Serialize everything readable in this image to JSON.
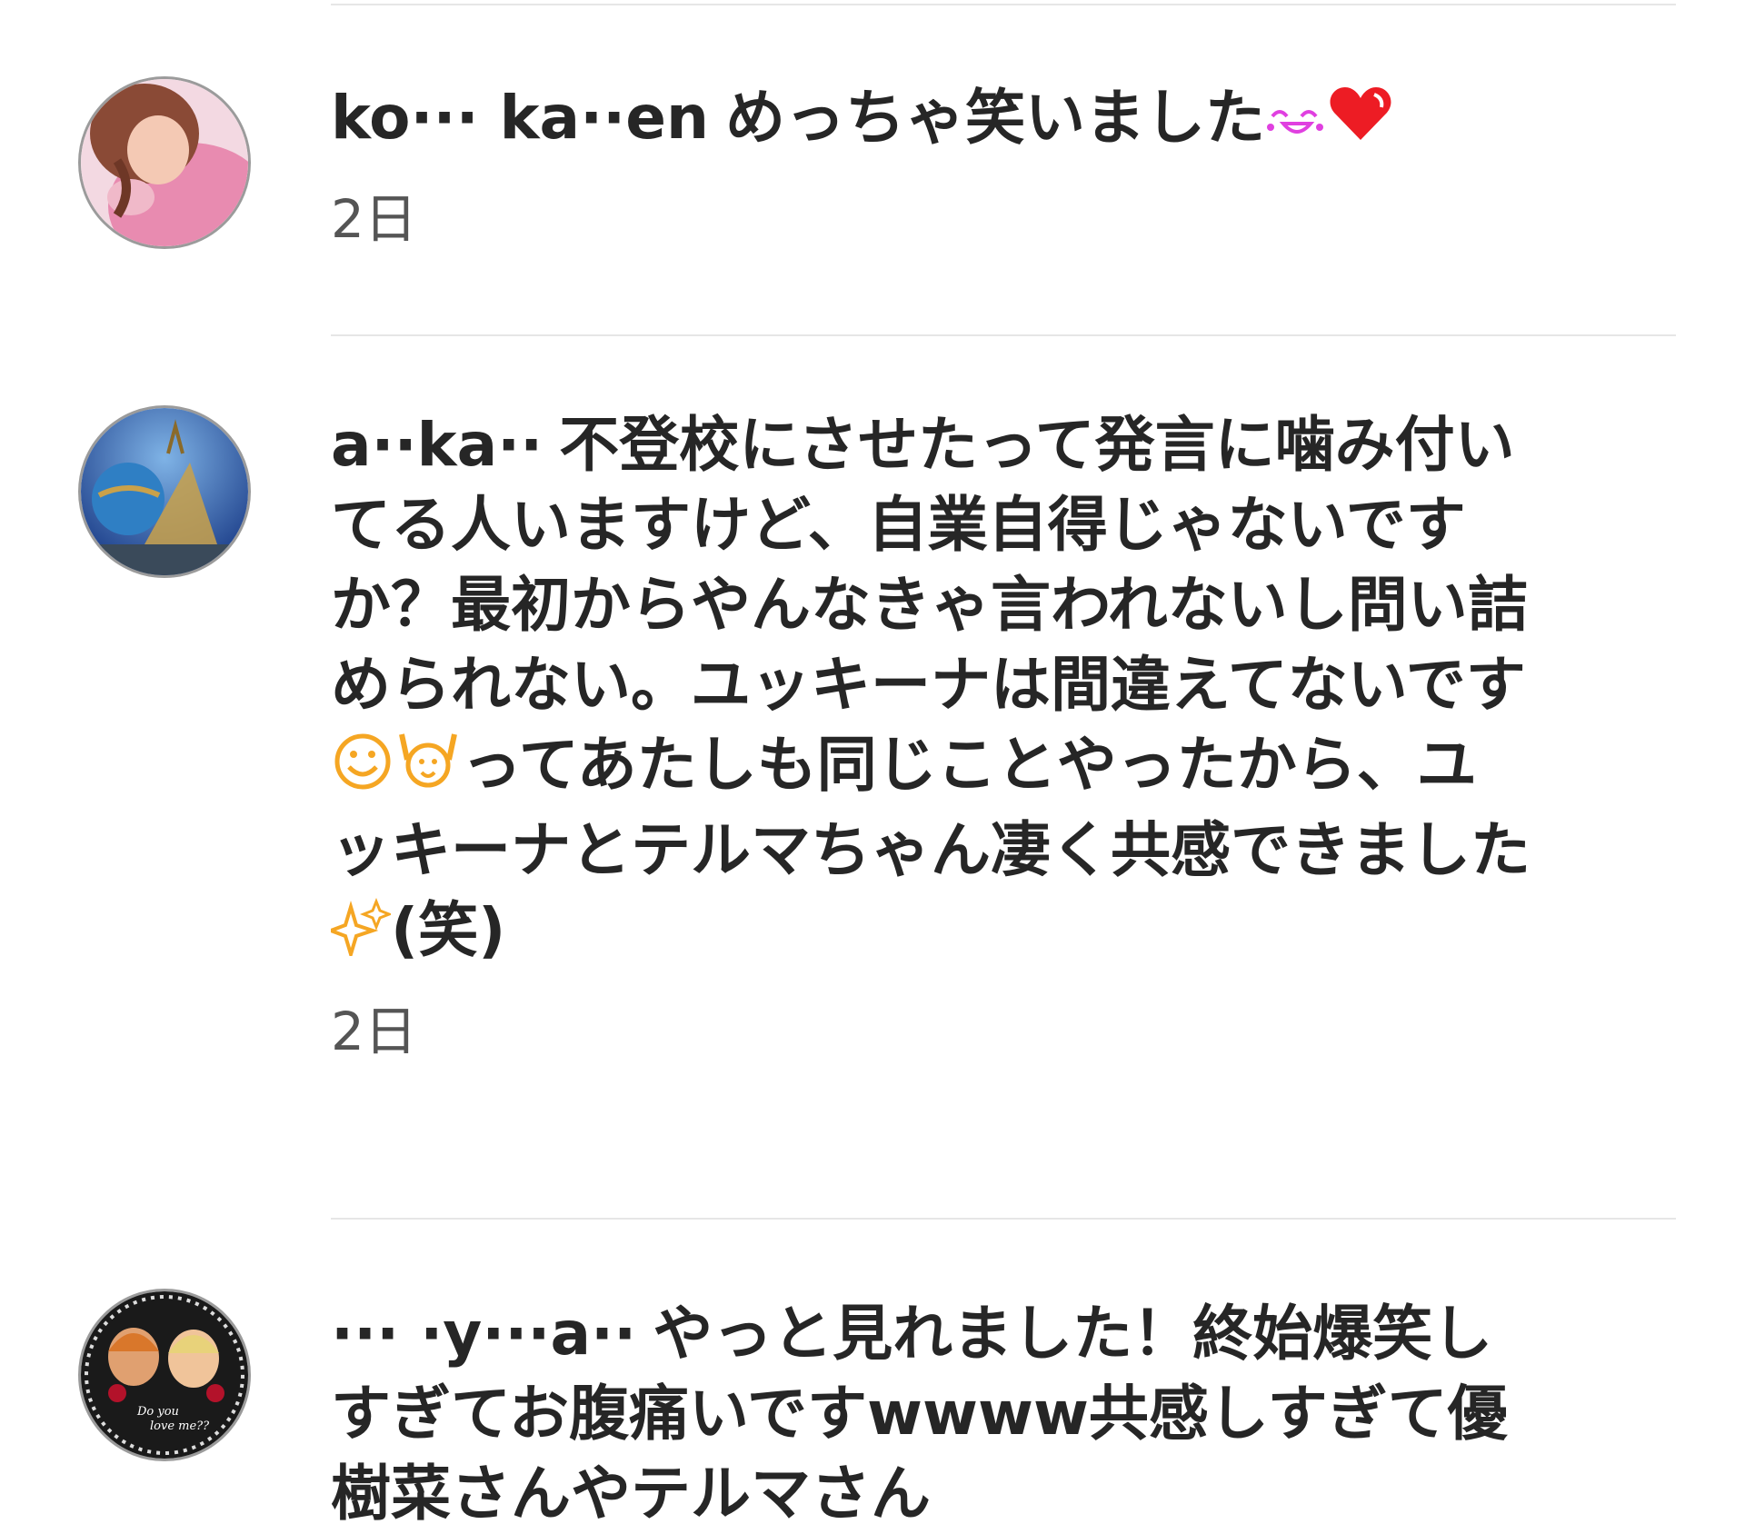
{
  "comments": [
    {
      "username": "ko··· ka··en",
      "text": "めっちゃ笑いました",
      "time": "2日",
      "emoji": [
        "laughing-face-icon",
        "heart-icon"
      ]
    },
    {
      "username": "a··ka··",
      "text": "不登校にさせたって発言に噛み付いてる人いますけど、自業自得じゃないですか？最初からやんなきゃ言われないし問い詰められない。ユッキーナは間違えてないです",
      "text2": "ってあたしも同じことやったから、ユッキーナとテルマちゃん凄く共感できました",
      "text3": "(笑)",
      "time": "2日",
      "emoji": [
        "smile-icon",
        "raised-hands-icon",
        "sparkle-icon"
      ]
    },
    {
      "username": "··· ·y···a··",
      "text": "やっと見れました！終始爆笑しすぎてお腹痛いですwwww共感しすぎて優樹菜さんやテルマさん",
      "avatar_caption": "Do you love me??"
    }
  ],
  "colors": {
    "text": "#262626",
    "time": "#555555",
    "divider": "#e6e6e6",
    "heart": "#ed1c24",
    "emoji_orange": "#f5a623",
    "emoji_pink": "#e040e0"
  }
}
